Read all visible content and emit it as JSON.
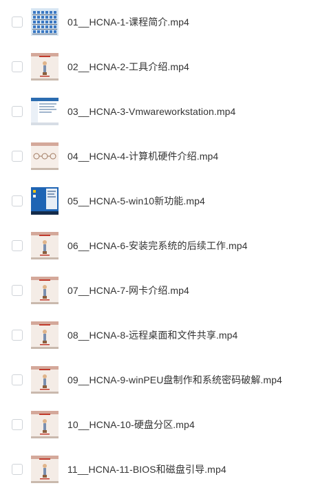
{
  "files": [
    {
      "name": "01__HCNA-1-课程简介.mp4",
      "thumb": "icon-grid"
    },
    {
      "name": "02__HCNA-2-工具介绍.mp4",
      "thumb": "slide"
    },
    {
      "name": "03__HCNA-3-Vmwareworkstation.mp4",
      "thumb": "window"
    },
    {
      "name": "04__HCNA-4-计算机硬件介绍.mp4",
      "thumb": "diagram"
    },
    {
      "name": "05__HCNA-5-win10新功能.mp4",
      "thumb": "desktop"
    },
    {
      "name": "06__HCNA-6-安装完系统的后续工作.mp4",
      "thumb": "slide"
    },
    {
      "name": "07__HCNA-7-网卡介绍.mp4",
      "thumb": "slide"
    },
    {
      "name": "08__HCNA-8-远程桌面和文件共享.mp4",
      "thumb": "slide"
    },
    {
      "name": "09__HCNA-9-winPEU盘制作和系统密码破解.mp4",
      "thumb": "slide"
    },
    {
      "name": "10__HCNA-10-硬盘分区.mp4",
      "thumb": "slide"
    },
    {
      "name": "11__HCNA-11-BIOS和磁盘引导.mp4",
      "thumb": "slide"
    }
  ]
}
